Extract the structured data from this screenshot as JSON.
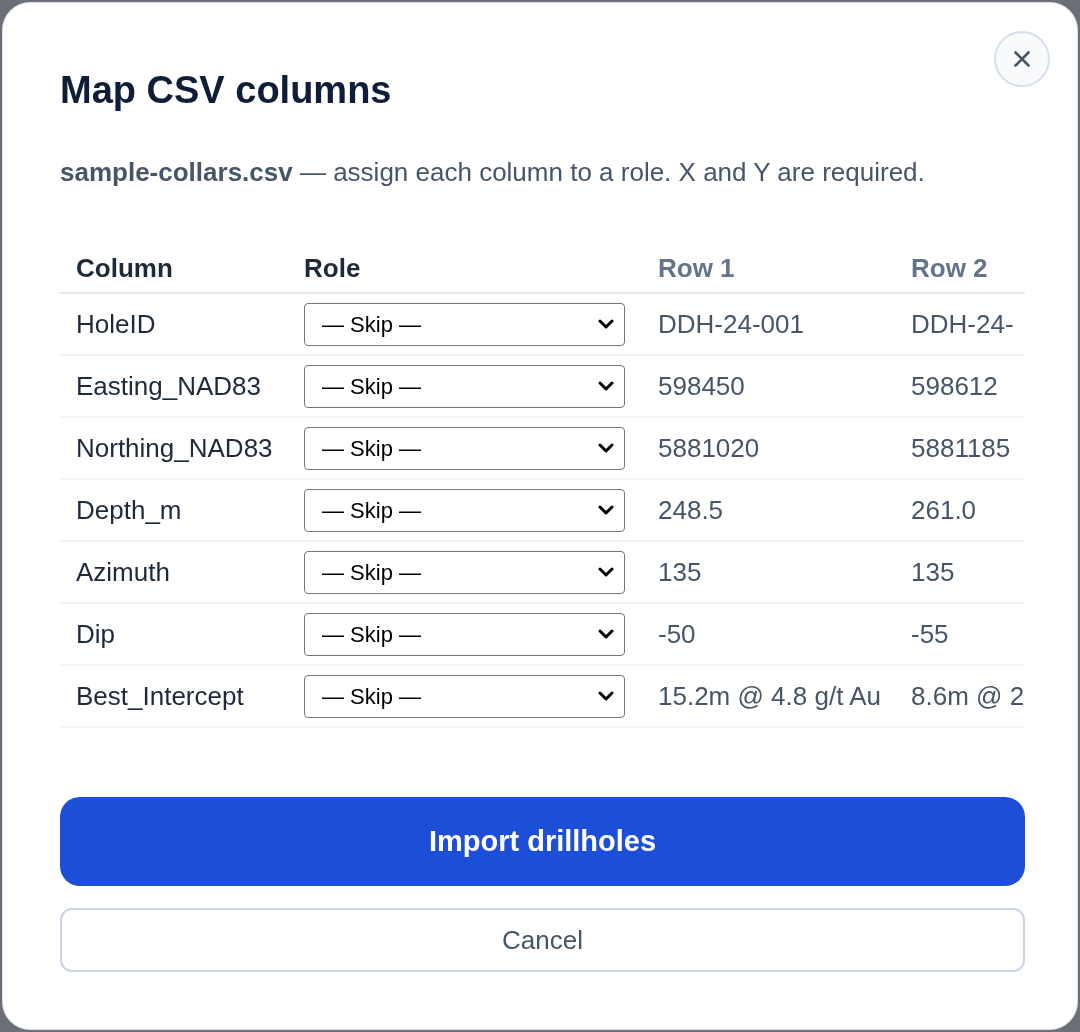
{
  "dialog": {
    "title": "Map CSV columns",
    "description": "**sample-collars.csv** — assign each column to a role. X and Y are required."
  },
  "table": {
    "columns": [
      {
        "label": "Column",
        "kind": "name"
      },
      {
        "label": "Role",
        "kind": "role"
      },
      {
        "label": "Row 1",
        "kind": "sample"
      },
      {
        "label": "Row 2",
        "kind": "sample"
      }
    ],
    "rows": [
      {
        "column": "HoleID",
        "role": "— Skip —",
        "samples": [
          "DDH-24-001",
          "DDH-24-"
        ]
      },
      {
        "column": "Easting_NAD83",
        "role": "— Skip —",
        "samples": [
          "598450",
          "598612"
        ]
      },
      {
        "column": "Northing_NAD83",
        "role": "— Skip —",
        "samples": [
          "5881020",
          "5881185"
        ]
      },
      {
        "column": "Depth_m",
        "role": "— Skip —",
        "samples": [
          "248.5",
          "261.0"
        ]
      },
      {
        "column": "Azimuth",
        "role": "— Skip —",
        "samples": [
          "135",
          "135"
        ]
      },
      {
        "column": "Dip",
        "role": "— Skip —",
        "samples": [
          "-50",
          "-55"
        ]
      },
      {
        "column": "Best_Intercept",
        "role": "— Skip —",
        "samples": [
          "15.2m @ 4.8 g/t Au",
          "8.6m @ 2"
        ]
      }
    ]
  },
  "buttons": [
    {
      "label": "Import drillholes",
      "kind": "primary"
    },
    {
      "label": "Cancel",
      "kind": "secondary"
    }
  ]
}
